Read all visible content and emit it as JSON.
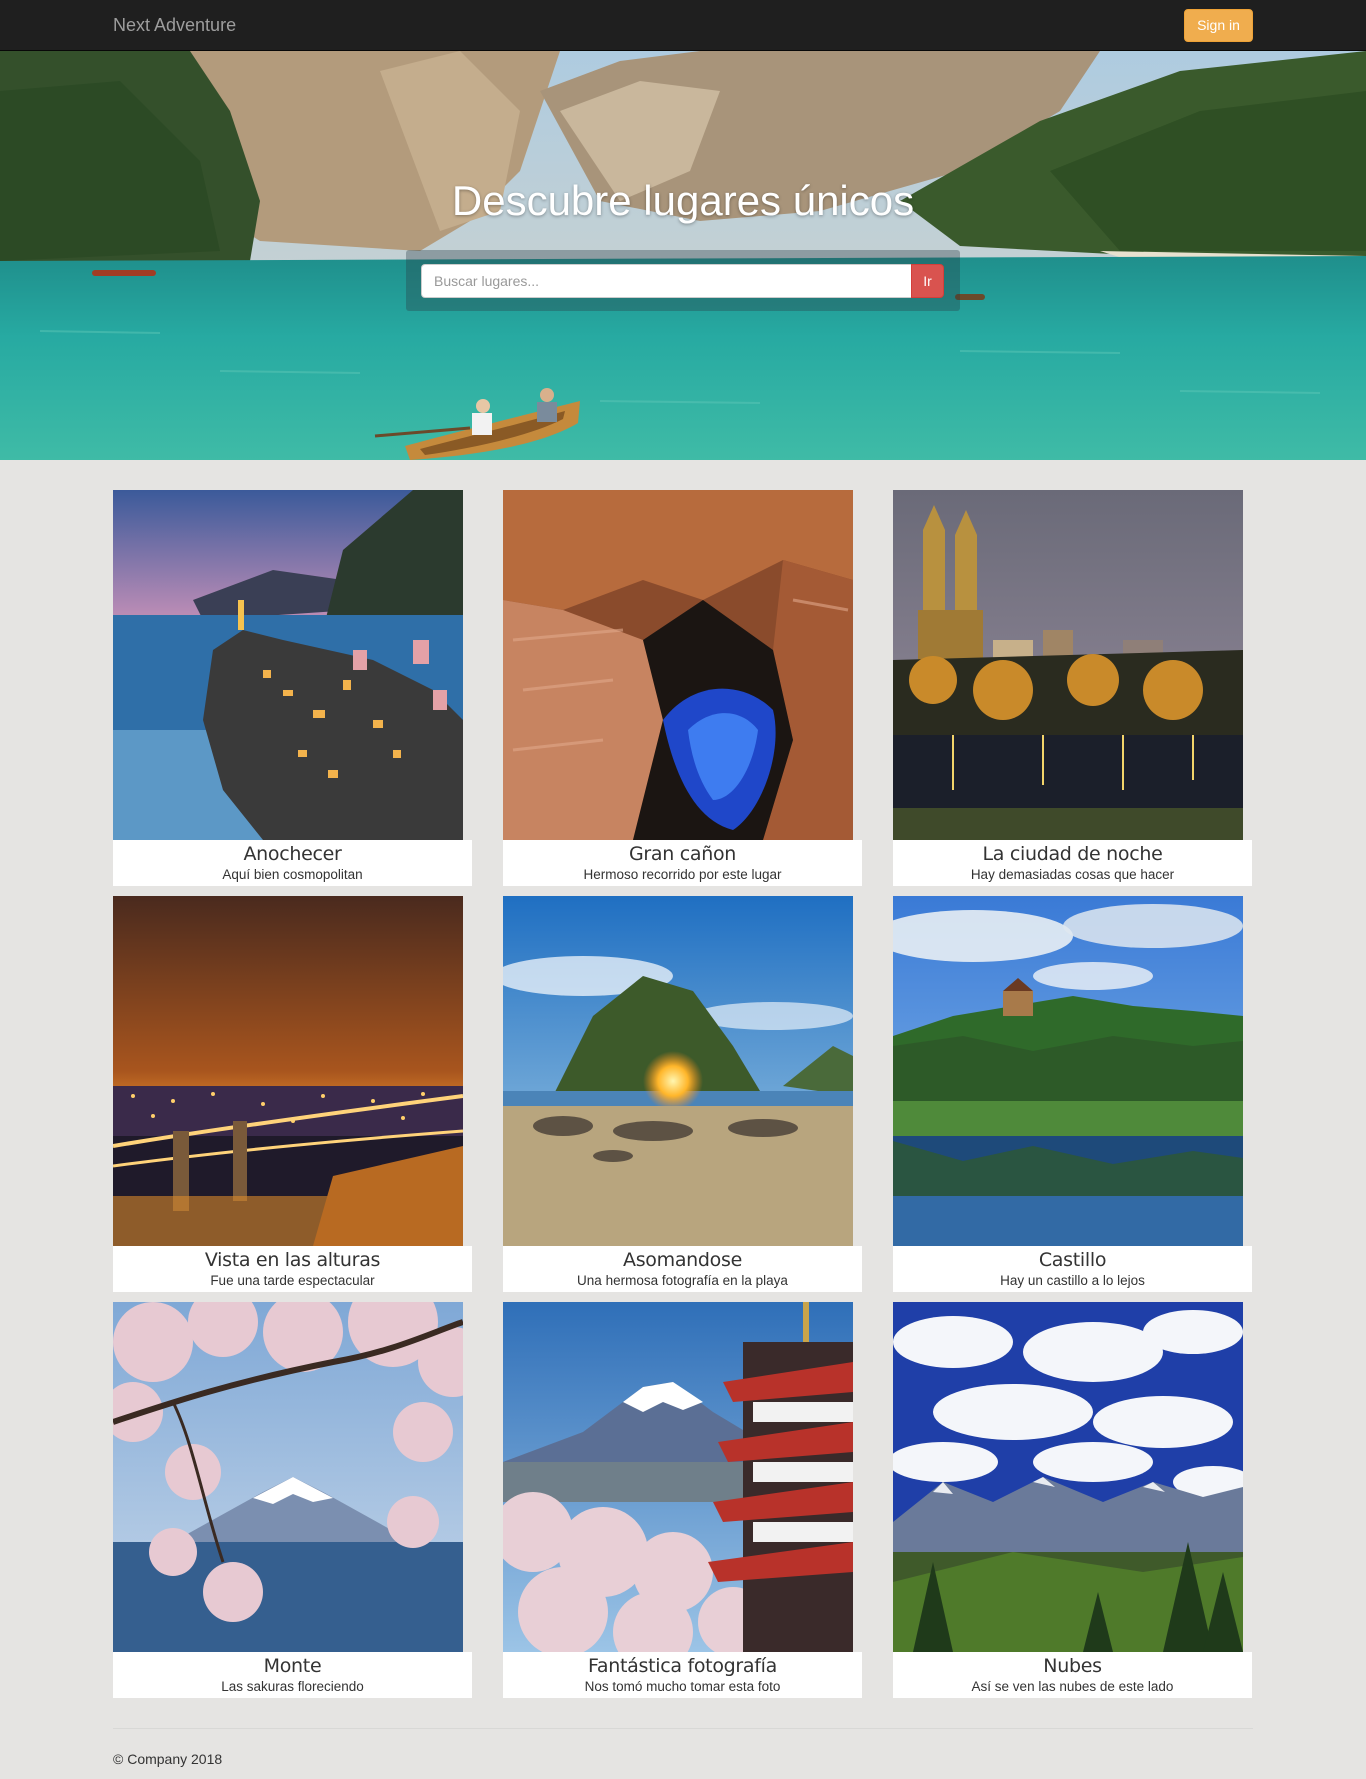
{
  "navbar": {
    "brand": "Next Adventure",
    "signin_label": "Sign in"
  },
  "hero": {
    "title": "Descubre lugares únicos",
    "search_placeholder": "Buscar lugares...",
    "search_button": "Ir"
  },
  "cards": [
    {
      "title": "Anochecer",
      "description": "Aquí bien cosmopolitan"
    },
    {
      "title": "Gran cañon",
      "description": "Hermoso recorrido por este lugar"
    },
    {
      "title": "La ciudad de noche",
      "description": "Hay demasiadas cosas que hacer"
    },
    {
      "title": "Vista en las alturas",
      "description": "Fue una tarde espectacular"
    },
    {
      "title": "Asomandose",
      "description": "Una hermosa fotografía en la playa"
    },
    {
      "title": "Castillo",
      "description": "Hay un castillo a lo lejos"
    },
    {
      "title": "Monte",
      "description": "Las sakuras floreciendo"
    },
    {
      "title": "Fantástica fotografía",
      "description": "Nos tomó mucho tomar esta foto"
    },
    {
      "title": "Nubes",
      "description": "Así se ven las nubes de este lado"
    }
  ],
  "footer": {
    "text": "© Company 2018"
  },
  "colors": {
    "navbar_bg": "#1f1f1f",
    "signin_bg": "#f0ad4e",
    "search_button_bg": "#d9534f",
    "page_bg": "#e5e4e2"
  }
}
